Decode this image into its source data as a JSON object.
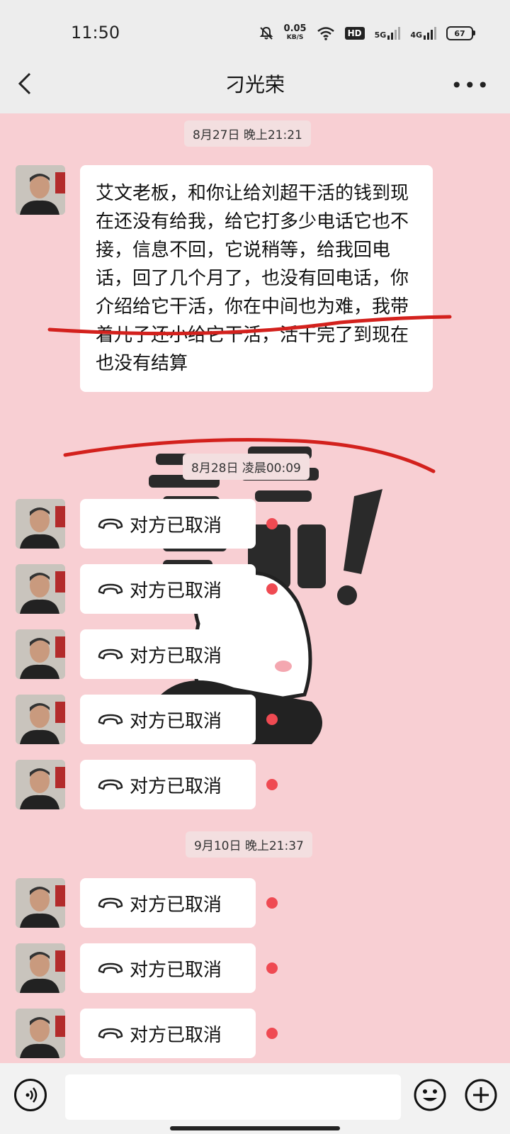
{
  "status": {
    "time": "11:50",
    "net_speed": "0.05",
    "net_unit": "KB/S",
    "hd": "HD",
    "sig1": "5G",
    "sig2": "4G",
    "battery": "67"
  },
  "header": {
    "title": "刁光荣"
  },
  "messages": {
    "ts1": "8月27日 晚上21:21",
    "text1": "艾文老板，和你让给刘超干活的钱到现在还没有给我，给它打多少电话它也不接，信息不回，它说稍等，给我回电话，回了几个月了，也没有回电话，你介绍给它干活，你在中间也为难，我带着儿子还小给它干活，活干完了到现在也没有结算",
    "ts2": "8月28日 凌晨00:09",
    "ts3": "9月10日 晚上21:37",
    "call_label": "对方已取消"
  }
}
